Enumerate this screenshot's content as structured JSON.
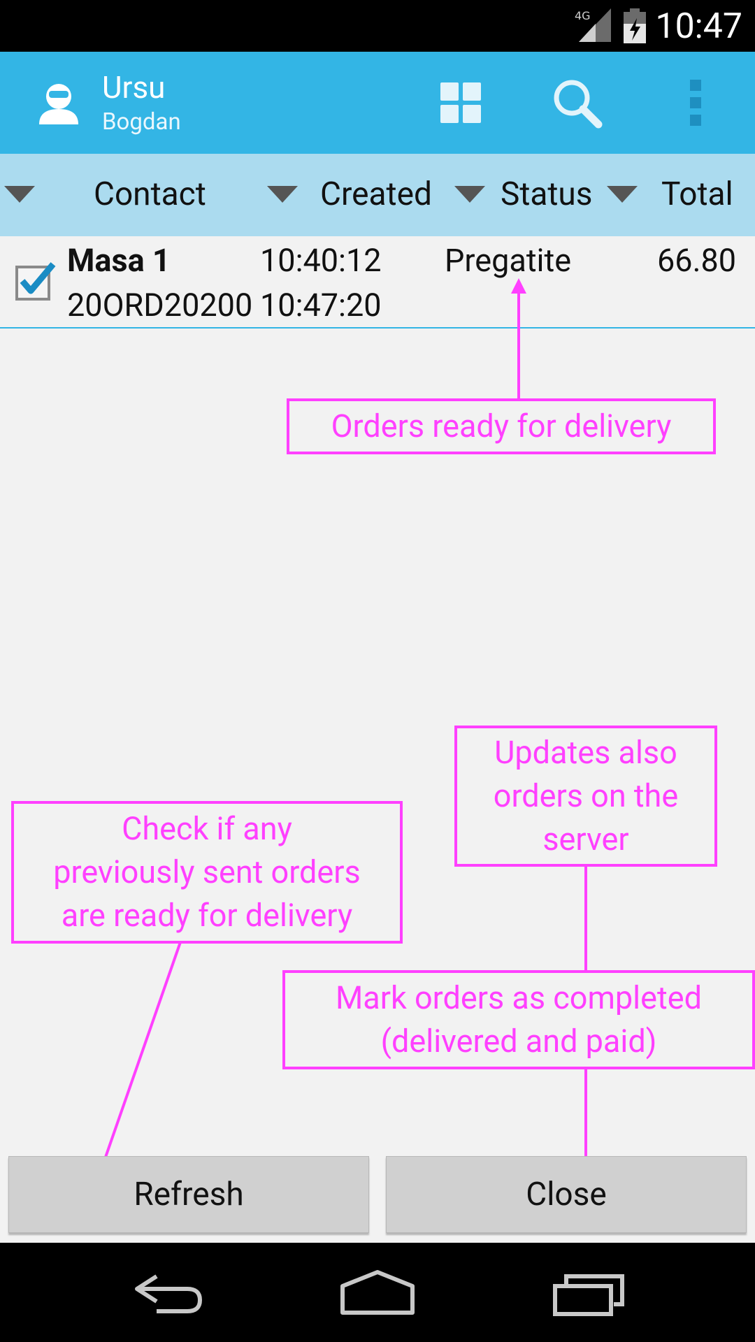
{
  "status_bar": {
    "network": "4G",
    "time": "10:47"
  },
  "action_bar": {
    "user_first": "Ursu",
    "user_last": "Bogdan",
    "icons": [
      "avatar-icon",
      "grid-icon",
      "search-icon",
      "overflow-menu-icon"
    ]
  },
  "columns": [
    "Contact",
    "Created",
    "Status",
    "Total"
  ],
  "orders": [
    {
      "checked": true,
      "contact": "Masa 1",
      "number": "20ORD20200",
      "created": "10:40:12",
      "updated": "10:47:20",
      "status": "Pregatite",
      "total": "66.80"
    }
  ],
  "annotations": {
    "ready": "Orders ready for delivery",
    "updates_server": [
      "Updates also",
      "orders on the",
      "server"
    ],
    "check_ready": [
      "Check if any",
      "previously sent orders",
      "are ready for delivery"
    ],
    "mark_completed": [
      "Mark orders as completed",
      "(delivered and paid)"
    ]
  },
  "buttons": {
    "refresh": "Refresh",
    "close": "Close"
  },
  "colors": {
    "action_bar": "#33b5e5",
    "column_header": "#abdbef",
    "annotation": "#ff40ff",
    "background": "#f2f2f2"
  }
}
